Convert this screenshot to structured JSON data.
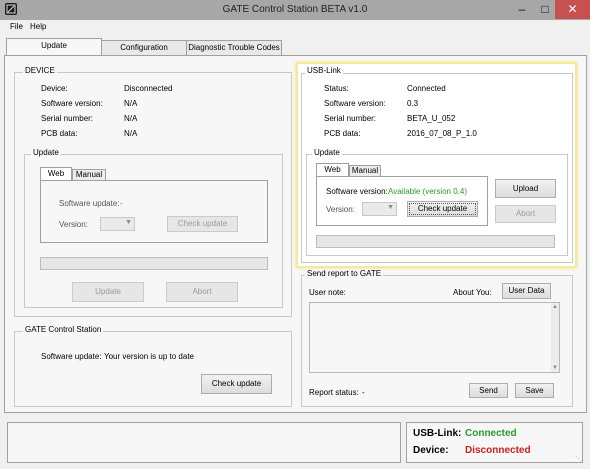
{
  "window": {
    "title": "GATE Control Station BETA v1.0"
  },
  "menu": {
    "file": "File",
    "help": "Help"
  },
  "tabs": [
    {
      "label": "Update"
    },
    {
      "label": "Configuration"
    },
    {
      "label": "Diagnostic Trouble Codes"
    }
  ],
  "device": {
    "legend": "DEVICE",
    "rows": [
      {
        "label": "Device:",
        "value": "Disconnected"
      },
      {
        "label": "Software version:",
        "value": "N/A"
      },
      {
        "label": "Serial number:",
        "value": "N/A"
      },
      {
        "label": "PCB data:",
        "value": "N/A"
      }
    ],
    "update": {
      "legend": "Update",
      "tab_web": "Web",
      "tab_manual": "Manual",
      "software_update_label": "Software update:",
      "software_update_value": "-",
      "version_label": "Version:",
      "check_update": "Check update",
      "update_button": "Update",
      "abort_button": "Abort"
    }
  },
  "gate_station": {
    "legend": "GATE Control Station",
    "software_update_label": "Software update:",
    "software_update_value": "Your version is up to date",
    "check_update": "Check update"
  },
  "usb_link": {
    "legend": "USB-Link",
    "rows": [
      {
        "label": "Status:",
        "value": "Connected"
      },
      {
        "label": "Software version:",
        "value": "0.3"
      },
      {
        "label": "Serial number:",
        "value": "BETA_U_052"
      },
      {
        "label": "PCB data:",
        "value": "2016_07_08_P_1.0"
      }
    ],
    "update": {
      "legend": "Update",
      "tab_web": "Web",
      "tab_manual": "Manual",
      "software_version_label": "Software version:",
      "software_version_value": "Available (version 0.4)",
      "version_label": "Version:",
      "check_update": "Check update",
      "upload_button": "Upload",
      "abort_button": "Abort"
    }
  },
  "report": {
    "legend": "Send report to GATE",
    "user_note_label": "User note:",
    "about_you_label": "About You:",
    "user_data_button": "User Data",
    "report_status_label": "Report status:",
    "report_status_value": "-",
    "send_button": "Send",
    "save_button": "Save"
  },
  "statusbar": {
    "usb_label": "USB-Link:",
    "usb_value": "Connected",
    "device_label": "Device:",
    "device_value": "Disconnected"
  },
  "colors": {
    "connected": "#2a9d2a",
    "disconnected": "#cc1f1f",
    "highlight": "#f5ea9a"
  }
}
